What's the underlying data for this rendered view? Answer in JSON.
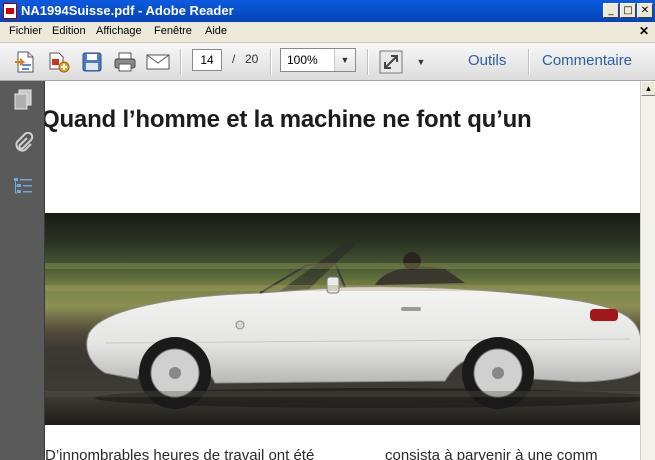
{
  "window": {
    "title": "NA1994Suisse.pdf - Adobe Reader"
  },
  "menu": {
    "items": [
      "Fichier",
      "Edition",
      "Affichage",
      "Fenêtre",
      "Aide"
    ]
  },
  "toolbar": {
    "page_current": "14",
    "page_separator": "/",
    "page_total": "20",
    "zoom": "100%",
    "tools_label": "Outils",
    "comment_label": "Commentaire"
  },
  "document": {
    "heading": "Quand l’homme et la machine ne font qu’un",
    "body_col1": "D’innombrables heures de travail ont été",
    "body_col2": "consista à parvenir à une comm"
  }
}
